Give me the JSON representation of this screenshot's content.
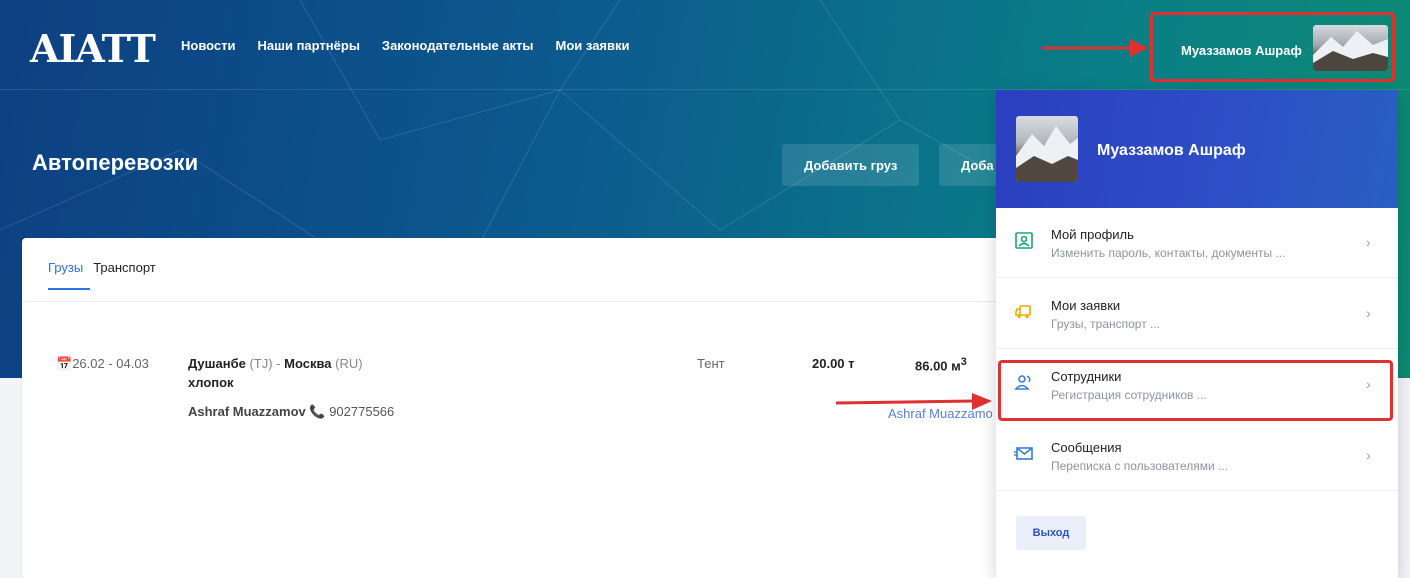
{
  "header": {
    "logo": "AIATT",
    "nav": [
      "Новости",
      "Наши партнёры",
      "Законодательные акты",
      "Мои заявки"
    ],
    "user_name": "Муаззамов Ашраф"
  },
  "hero": {
    "title": "Автоперевозки",
    "add_cargo_button": "Добавить груз",
    "add_transport_button": "Доба"
  },
  "tabs": [
    "Грузы",
    "Транспорт"
  ],
  "listing": {
    "date": "26.02 - 04.03",
    "from_city": "Душанбе",
    "from_country": "(TJ)",
    "route_sep": " - ",
    "to_city": "Москва",
    "to_country": "(RU)",
    "goods": "хлопок",
    "contact_name": "Ashraf Muazzamov",
    "phone": "902775566",
    "body_type": "Тент",
    "weight": "20.00 т",
    "volume": "86.00 м",
    "volume_sup": "3",
    "owner": "Ashraf Muazzamo"
  },
  "dropdown": {
    "name": "Муаззамов Ашраф",
    "items": [
      {
        "title": "Мой профиль",
        "subtitle": "Изменить пароль, контакты, документы ...",
        "icon": "profile-icon"
      },
      {
        "title": "Мои заявки",
        "subtitle": "Грузы, транспорт ...",
        "icon": "truck-icon"
      },
      {
        "title": "Сотрудники",
        "subtitle": "Регистрация сотрудников ...",
        "icon": "employees-icon"
      },
      {
        "title": "Сообщения",
        "subtitle": "Переписка с пользователями ...",
        "icon": "envelope-icon"
      }
    ],
    "chevron": "›",
    "logout": "Выход"
  },
  "colors": {
    "accent": "#2c72e0",
    "annotation_red": "#e03131",
    "dropdown_header": "#2b3fbf"
  }
}
